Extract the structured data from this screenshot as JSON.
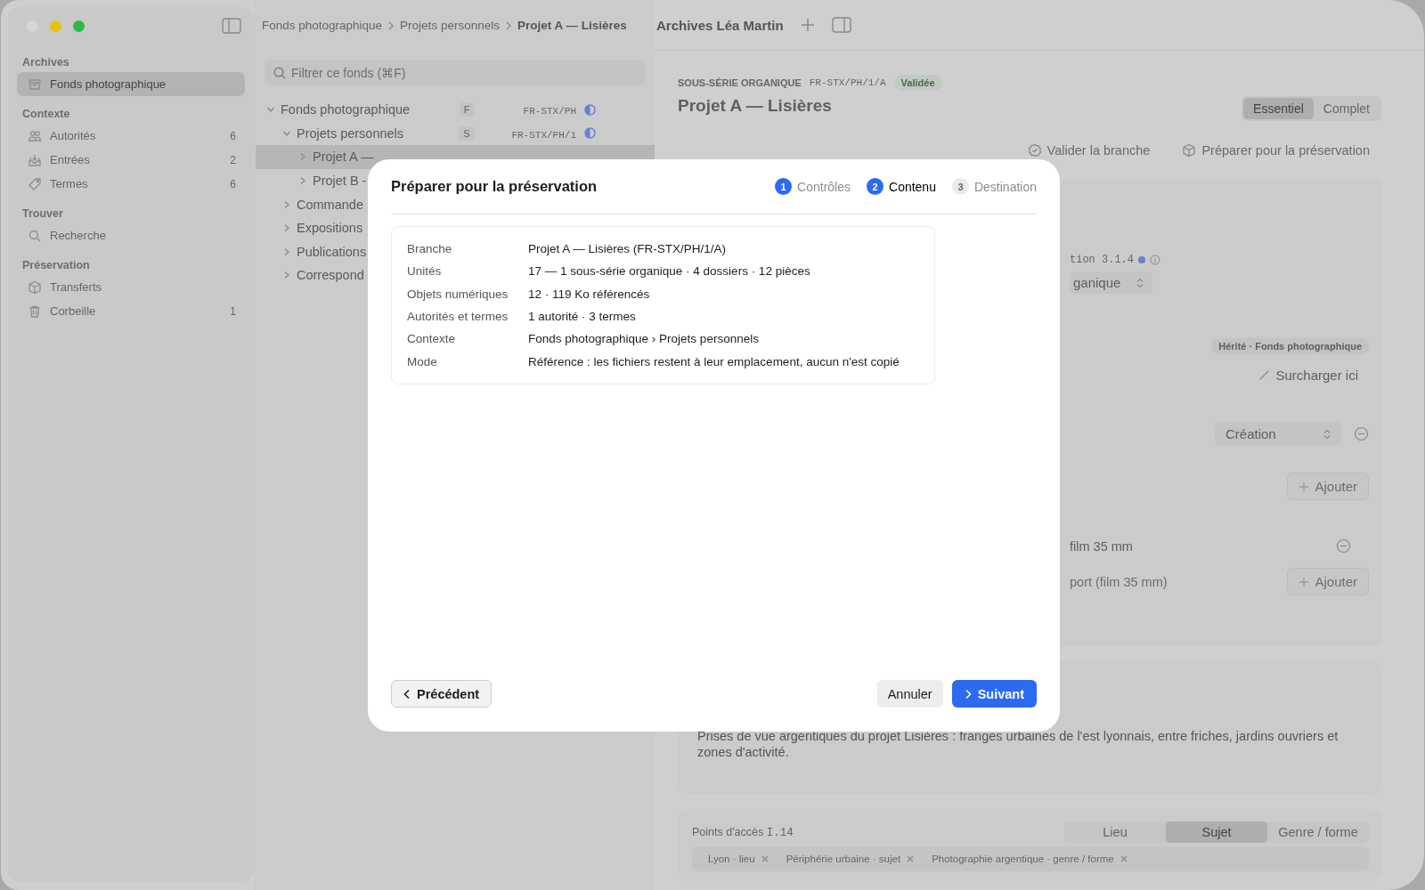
{
  "sidebar": {
    "sections": [
      {
        "title": "Archives",
        "items": [
          {
            "label": "Fonds photographique",
            "selected": true
          }
        ]
      },
      {
        "title": "Contexte",
        "items": [
          {
            "label": "Autorités",
            "count": "6",
            "selected": false
          },
          {
            "label": "Entrées",
            "count": "2",
            "selected": false
          },
          {
            "label": "Termes",
            "count": "6",
            "selected": false
          }
        ]
      },
      {
        "title": "Trouver",
        "items": [
          {
            "label": "Recherche",
            "selected": false
          }
        ]
      },
      {
        "title": "Préservation",
        "items": [
          {
            "label": "Transferts",
            "selected": false
          },
          {
            "label": "Corbeille",
            "count": "1",
            "selected": false
          }
        ]
      }
    ]
  },
  "breadcrumb": [
    {
      "label": "Fonds photographique",
      "current": false
    },
    {
      "label": "Projets personnels",
      "current": false
    },
    {
      "label": "Projet A — Lisières",
      "current": true
    }
  ],
  "filter": {
    "placeholder": "Filtrer ce fonds (⌘F)"
  },
  "tree": [
    {
      "label": "Fonds photographique",
      "badge": "F",
      "code": "FR-STX/PH",
      "partially_complete": true,
      "expanded": true,
      "selected": false,
      "children": [
        {
          "label": "Projets personnels",
          "badge": "S",
          "code": "FR-STX/PH/1",
          "partially_complete": true,
          "expanded": true,
          "selected": false,
          "children": [
            {
              "label": "Projet A —",
              "expanded": false,
              "selected": true
            },
            {
              "label": "Projet B -",
              "expanded": false,
              "selected": false
            }
          ]
        },
        {
          "label": "Commande",
          "expanded": false,
          "selected": false
        },
        {
          "label": "Expositions",
          "expanded": false,
          "selected": false
        },
        {
          "label": "Publications",
          "expanded": false,
          "selected": false
        },
        {
          "label": "Correspond",
          "expanded": false,
          "selected": false
        }
      ]
    }
  ],
  "toolbar": {
    "title": "Archives Léa Martin"
  },
  "record": {
    "level": "SOUS-SÉRIE ORGANIQUE",
    "code": "FR-STX/PH/1/A",
    "status": "Validée",
    "title": "Projet A — Lisières",
    "view_modes": [
      {
        "label": "Essentiel",
        "selected": true
      },
      {
        "label": "Complet",
        "selected": false
      }
    ],
    "actions": [
      {
        "kind": "validate",
        "label": "Valider la branche"
      },
      {
        "kind": "package",
        "label": "Préparer pour la préservation"
      }
    ]
  },
  "details": {
    "field_label": "tion 3.1.4",
    "modified": true,
    "level_select": "ganique",
    "inherited_badge": "Hérité · Fonds photographique",
    "override": "Surcharger ici",
    "date_type": "Création",
    "add_date": "Ajouter",
    "support_value": "film 35 mm",
    "support_placeholder": "port (film 35 mm)",
    "add_support": "Ajouter"
  },
  "summary_text": "Prises de vue argentiques du projet Lisières : franges urbaines de l'est lyonnais, entre friches, jardins ouvriers et zones d'activité.",
  "access_points": {
    "label": "Points d'accès",
    "code": "I.14",
    "tabs": [
      {
        "label": "Lieu",
        "selected": false
      },
      {
        "label": "Sujet",
        "selected": true
      },
      {
        "label": "Genre / forme",
        "selected": false
      }
    ],
    "tags": [
      {
        "label": "Lyon · lieu"
      },
      {
        "label": "Périphérie urbaine · sujet"
      },
      {
        "label": "Photographie argentique · genre / forme"
      }
    ]
  },
  "dialog": {
    "title": "Préparer pour la préservation",
    "steps": [
      {
        "number": "1",
        "label": "Contrôles",
        "reached": true,
        "selected": false
      },
      {
        "number": "2",
        "label": "Contenu",
        "reached": true,
        "selected": true
      },
      {
        "number": "3",
        "label": "Destination",
        "reached": false,
        "selected": false
      }
    ],
    "rows": [
      {
        "label": "Branche",
        "value": "Projet A — Lisières (FR-STX/PH/1/A)"
      },
      {
        "label": "Unités",
        "value": "17 — 1 sous-série organique · 4 dossiers · 12 pièces"
      },
      {
        "label": "Objets numériques",
        "value": "12 · 119 Ko référencés"
      },
      {
        "label": "Autorités et termes",
        "value": "1 autorité · 3 termes"
      },
      {
        "label": "Contexte",
        "value": "Fonds photographique › Projets personnels"
      },
      {
        "label": "Mode",
        "value": "Référence : les fichiers restent à leur emplacement, aucun n'est copié"
      }
    ],
    "back": "Précédent",
    "cancel": "Annuler",
    "next": "Suivant"
  }
}
